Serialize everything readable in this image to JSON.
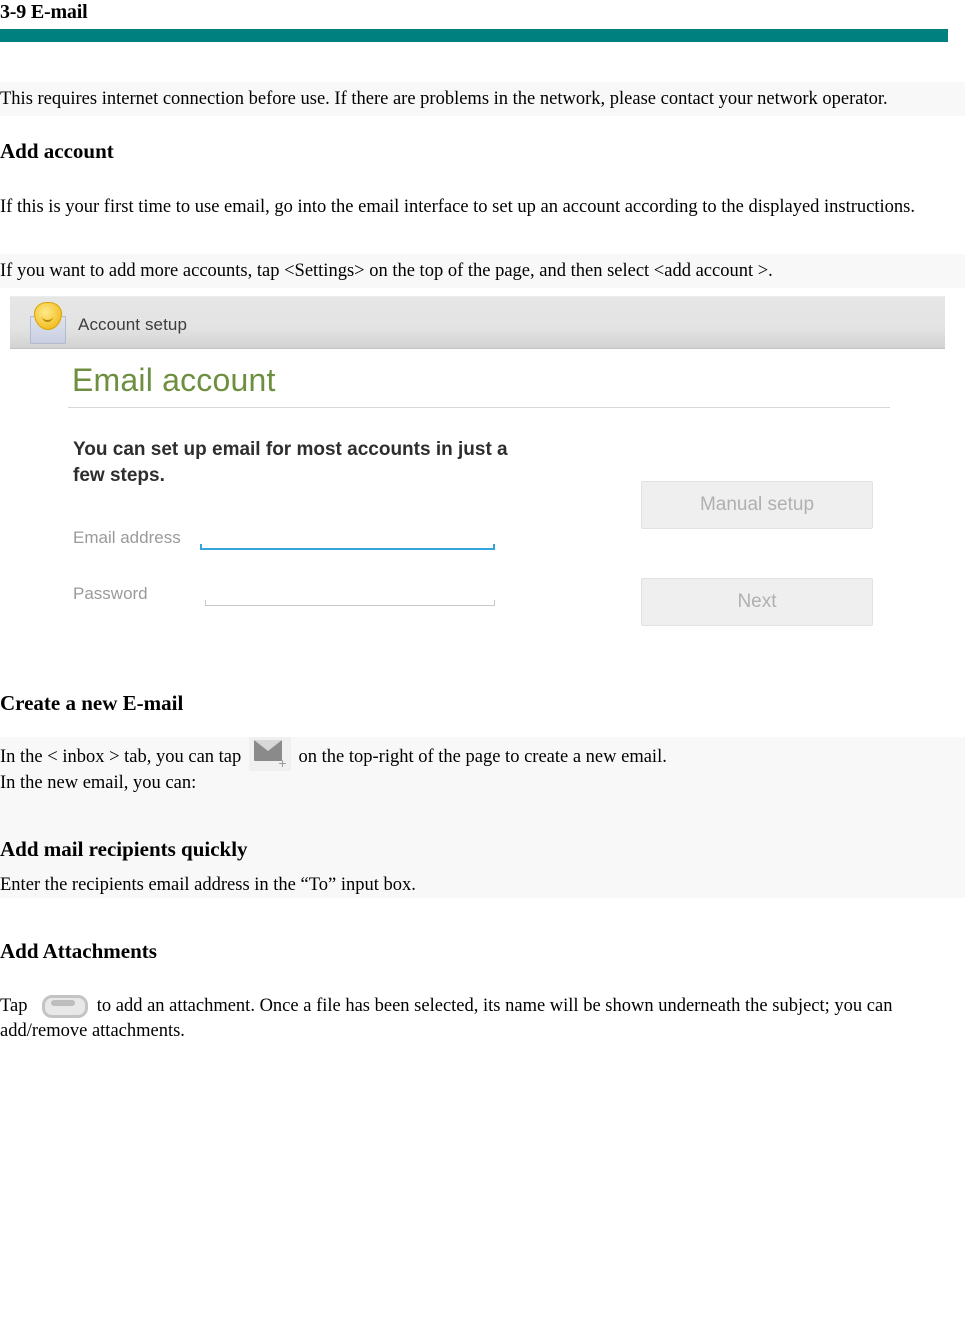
{
  "document": {
    "title": "3-9 E-mail",
    "accent_color": "#00807f"
  },
  "sections": [
    {
      "intro_paragraph": "This requires internet connection before use. If there are problems in the network, please contact your network operator."
    },
    {
      "heading": "Add account",
      "paragraph_1": "If this is your first time to use email, go into the email interface to set up an account according to the displayed instructions.",
      "paragraph_2": "If you want to add more accounts, tap <Settings> on the top of the page, and then select <add account >."
    },
    {
      "heading": "Create a new E-mail",
      "line_1_before_icon": "In the < inbox > tab, you can tap",
      "line_1_after_icon": "on the top-right of the page to create a new email.",
      "line_2": "In the new email, you can:"
    },
    {
      "heading": "Add mail recipients quickly",
      "paragraph": "Enter the recipients email address in the “To” input box."
    },
    {
      "heading": "Add Attachments",
      "line_before_icon": "Tap",
      "line_after_icon": "to add an attachment. Once a file has been selected, its name will be shown underneath the subject; you can add/remove attachments."
    }
  ],
  "screenshot": {
    "titlebar_label": "Account setup",
    "titlebar_icon": "email-setup-icon",
    "page_heading": "Email account",
    "page_heading_color": "#6d8f3f",
    "blurb": "You can set up email for most accounts in just a few steps.",
    "fields": [
      {
        "label": "Email address",
        "value": "",
        "state": "focused",
        "underline_color": "#34a5dc"
      },
      {
        "label": "Password",
        "value": "",
        "state": "normal",
        "underline_color": "#c9c9c9"
      }
    ],
    "buttons": [
      {
        "label": "Manual setup"
      },
      {
        "label": "Next"
      }
    ]
  },
  "inline_icons": {
    "compose": "compose-mail-icon",
    "attach": "attachment-clip-icon"
  }
}
